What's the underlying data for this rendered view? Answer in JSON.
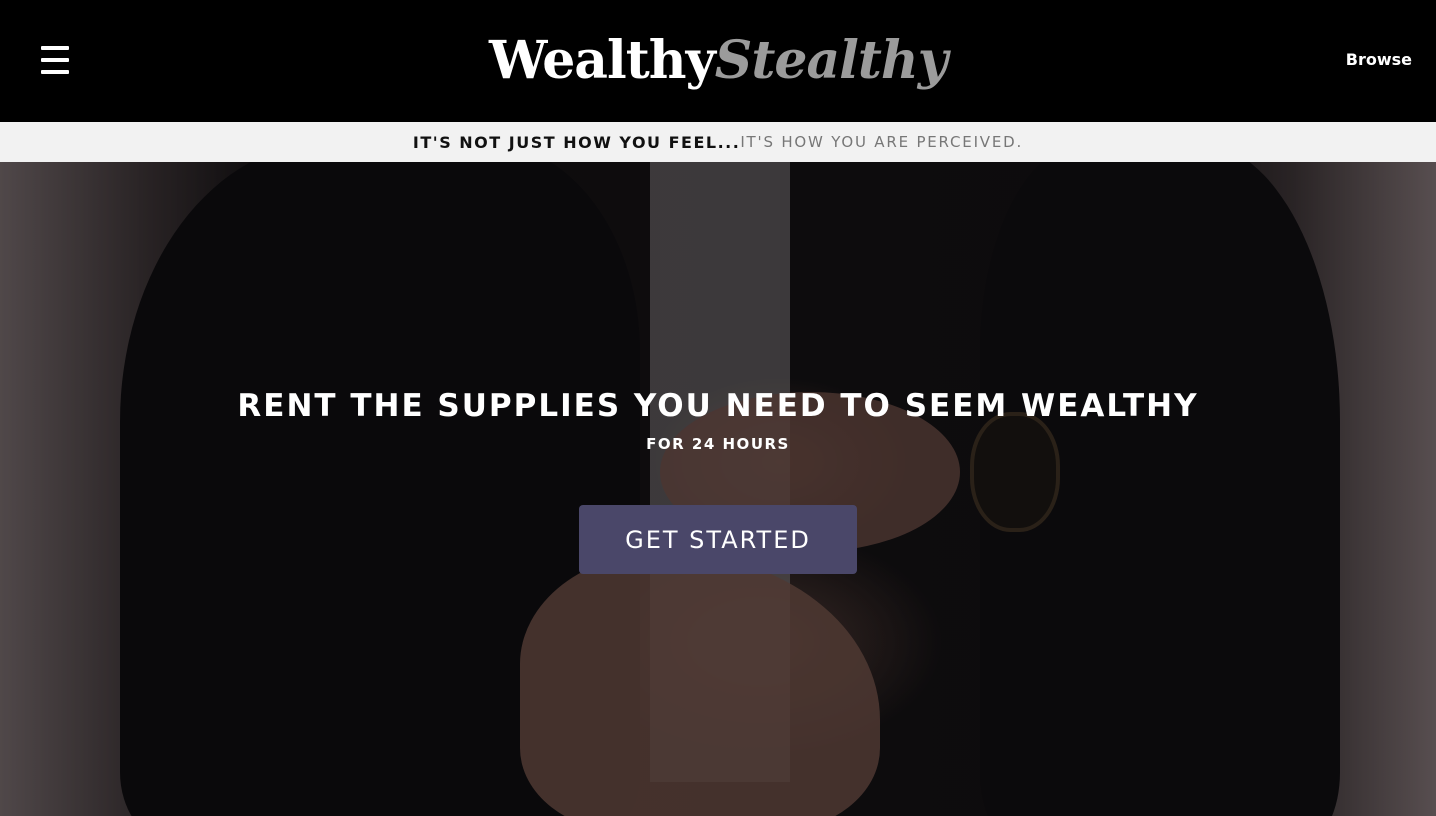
{
  "header": {
    "logo_part1": "Wealthy",
    "logo_part2": "Stealthy",
    "browse_label": "Browse",
    "menu_icon": "hamburger-menu-icon"
  },
  "tagline": {
    "bold": "It's not just how you feel...",
    "light": "it's how you are perceived."
  },
  "hero": {
    "headline": "Rent the supplies you need to seem wealthy",
    "subhead": "For 24 hours",
    "cta_label": "Get Started"
  },
  "colors": {
    "header_bg": "#000000",
    "tagline_bg": "#f2f2f2",
    "cta_bg": "#4a4769",
    "logo_secondary": "#9b9b9b"
  }
}
